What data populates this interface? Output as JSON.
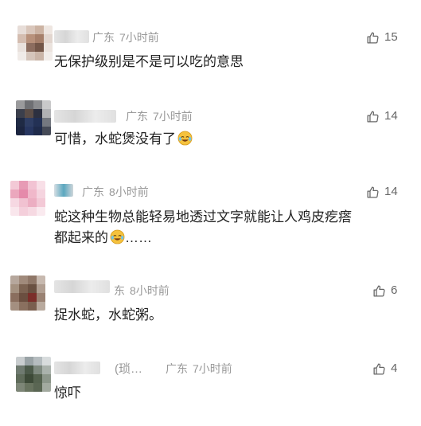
{
  "comments": [
    {
      "location": "广东",
      "time": "7小时前",
      "likes": "15",
      "text": "无保护级别是不是可以吃的意思",
      "emoji_after": false
    },
    {
      "location": "广东",
      "time": "7小时前",
      "likes": "14",
      "text": "可惜，水蛇煲没有了",
      "emoji_after": true
    },
    {
      "location": "广东",
      "time": "8小时前",
      "likes": "14",
      "text_line1": "蛇这种生物总能轻易地透过文字就能让人鸡皮疙瘩",
      "text_line2a": "都起来的",
      "text_line2b": "……"
    },
    {
      "location": "东",
      "time": "8小时前",
      "likes": "6",
      "text": "捉水蛇，水蛇粥。"
    },
    {
      "name_partial": "(琐…",
      "location": "广东",
      "time": "7小时前",
      "likes": "4",
      "text": "惊吓"
    }
  ],
  "icons": {
    "like": "thumbs-up-icon",
    "emoji": "laugh-cry-emoji-icon"
  },
  "colors": {
    "meta": "#999999",
    "text": "#222222",
    "likes": "#666666"
  }
}
